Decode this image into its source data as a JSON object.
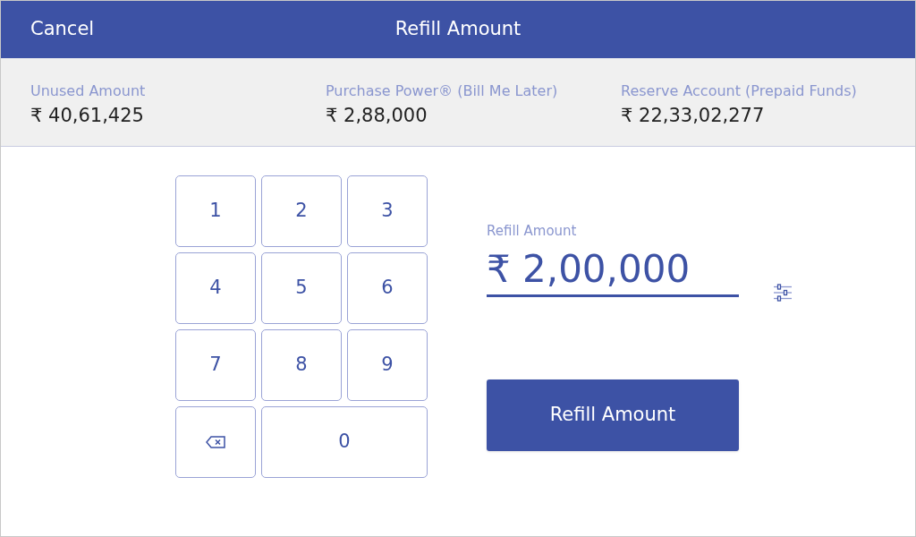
{
  "header": {
    "cancel": "Cancel",
    "title": "Refill Amount"
  },
  "balances": [
    {
      "label": "Unused Amount",
      "value": "₹ 40,61,425"
    },
    {
      "label": "Purchase Power® (Bill Me Later)",
      "value": "₹ 2,88,000"
    },
    {
      "label": "Reserve Account (Prepaid Funds)",
      "value": "₹ 22,33,02,277"
    }
  ],
  "keypad": [
    {
      "kind": "digit",
      "label": "1",
      "wide": false
    },
    {
      "kind": "digit",
      "label": "2",
      "wide": false
    },
    {
      "kind": "digit",
      "label": "3",
      "wide": false
    },
    {
      "kind": "digit",
      "label": "4",
      "wide": false
    },
    {
      "kind": "digit",
      "label": "5",
      "wide": false
    },
    {
      "kind": "digit",
      "label": "6",
      "wide": false
    },
    {
      "kind": "digit",
      "label": "7",
      "wide": false
    },
    {
      "kind": "digit",
      "label": "8",
      "wide": false
    },
    {
      "kind": "digit",
      "label": "9",
      "wide": false
    },
    {
      "kind": "backspace",
      "wide": false
    },
    {
      "kind": "digit",
      "label": "0",
      "wide": true
    }
  ],
  "amount_field": {
    "label": "Refill Amount",
    "value": "₹ 2,00,000"
  },
  "submit_button": "Refill Amount"
}
